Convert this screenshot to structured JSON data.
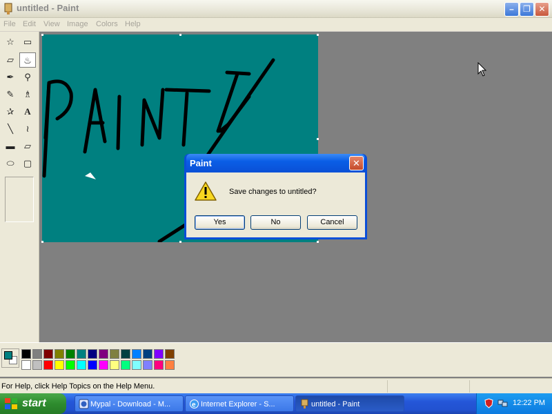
{
  "window": {
    "title": "untitled - Paint",
    "min_glyph": "–",
    "max_glyph": "❐",
    "close_glyph": "✕"
  },
  "menu": {
    "items": [
      "File",
      "Edit",
      "View",
      "Image",
      "Colors",
      "Help"
    ]
  },
  "tools": [
    {
      "name": "free-form-select",
      "glyph": "☆"
    },
    {
      "name": "rect-select",
      "glyph": "▭"
    },
    {
      "name": "eraser",
      "glyph": "▱"
    },
    {
      "name": "fill-with-color",
      "glyph": "♨"
    },
    {
      "name": "pick-color",
      "glyph": "✒"
    },
    {
      "name": "magnifier",
      "glyph": "⚲"
    },
    {
      "name": "pencil",
      "glyph": "✎"
    },
    {
      "name": "brush",
      "glyph": "♗"
    },
    {
      "name": "airbrush",
      "glyph": "✰"
    },
    {
      "name": "text",
      "glyph": "A"
    },
    {
      "name": "line",
      "glyph": "╲"
    },
    {
      "name": "curve",
      "glyph": "≀"
    },
    {
      "name": "rectangle",
      "glyph": "▬"
    },
    {
      "name": "polygon",
      "glyph": "▱"
    },
    {
      "name": "ellipse",
      "glyph": "⬭"
    },
    {
      "name": "rounded-rectangle",
      "glyph": "▢"
    }
  ],
  "palette": {
    "foreground": "#008080",
    "background": "#ffffff",
    "top_row": [
      "#000000",
      "#808080",
      "#800000",
      "#808000",
      "#008000",
      "#008080",
      "#000080",
      "#800080",
      "#808040",
      "#004040",
      "#0080ff",
      "#004080",
      "#8000ff",
      "#804000"
    ],
    "bottom_row": [
      "#ffffff",
      "#c0c0c0",
      "#ff0000",
      "#ffff00",
      "#00ff00",
      "#00ffff",
      "#0000ff",
      "#ff00ff",
      "#ffff80",
      "#00ff80",
      "#80ffff",
      "#8080ff",
      "#ff0080",
      "#ff8040"
    ]
  },
  "status": {
    "help_text": "For Help, click Help Topics on the Help Menu."
  },
  "dialog": {
    "title": "Paint",
    "message": "Save changes to untitled?",
    "yes_label": "Yes",
    "no_label": "No",
    "cancel_label": "Cancel",
    "close_glyph": "✕"
  },
  "taskbar": {
    "start_label": "start",
    "tasks": [
      {
        "label": "Mypal - Download - M...",
        "active": false
      },
      {
        "label": "Internet Explorer - S...",
        "active": false
      },
      {
        "label": "untitled - Paint",
        "active": true
      }
    ],
    "clock": "12:22 PM"
  }
}
